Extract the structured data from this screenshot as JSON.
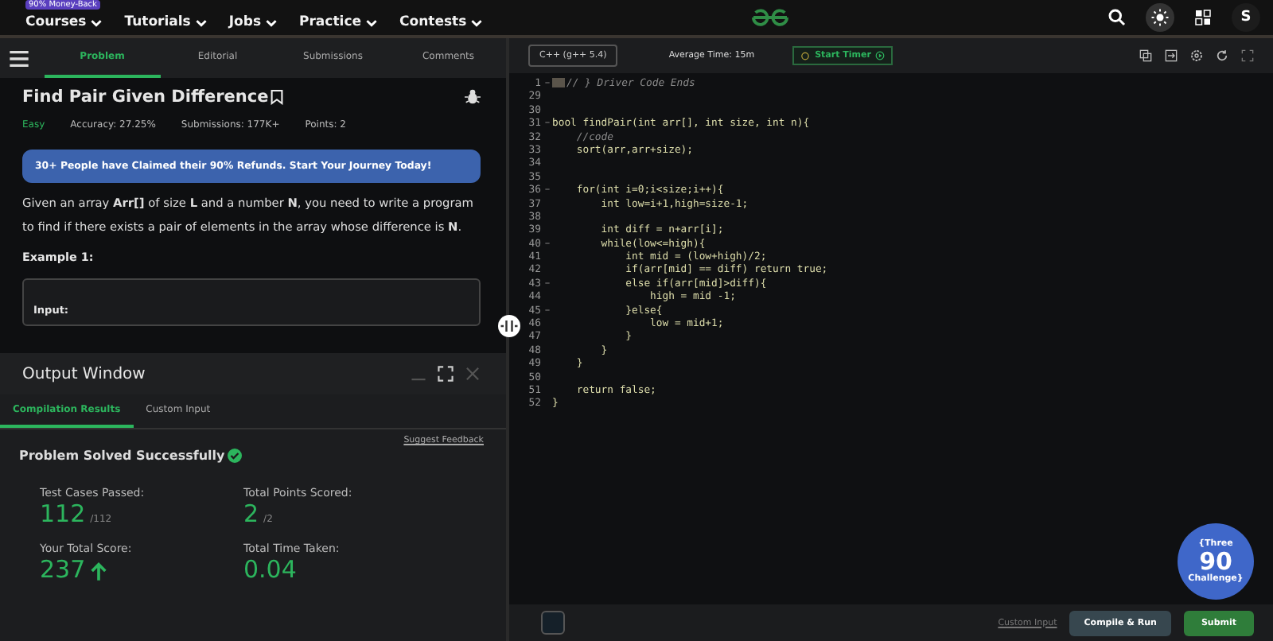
{
  "top_nav": {
    "promo_badge": "90% Money-Back",
    "items": [
      {
        "label": "Courses"
      },
      {
        "label": "Tutorials"
      },
      {
        "label": "Jobs"
      },
      {
        "label": "Practice"
      },
      {
        "label": "Contests"
      }
    ],
    "avatar": "S"
  },
  "problem_tabs": [
    {
      "label": "Problem",
      "selected": true
    },
    {
      "label": "Editorial",
      "selected": false
    },
    {
      "label": "Submissions",
      "selected": false
    },
    {
      "label": "Comments",
      "selected": false
    }
  ],
  "problem": {
    "title": "Find Pair Given Difference",
    "difficulty": "Easy",
    "accuracy": "Accuracy: 27.25%",
    "submissions": "Submissions: 177K+",
    "points": "Points: 2",
    "banner": "30+ People have Claimed their 90% Refunds. Start Your Journey Today!",
    "description": "Given an array **Arr[]** of size **L** and a number **N**, you need to write a program to find if there exists a pair of elements in the array whose difference is **N**.",
    "example_heading": "Example 1:",
    "example_input": "Input:"
  },
  "output_window": {
    "title": "Output Window",
    "tabs": [
      {
        "label": "Compilation Results",
        "selected": true
      },
      {
        "label": "Custom Input",
        "selected": false
      }
    ],
    "feedback_link": "Suggest Feedback",
    "status": "Problem Solved Successfully",
    "stats": [
      {
        "label": "Test Cases Passed:",
        "value": "112",
        "total": "/112",
        "arrow": false
      },
      {
        "label": "Total Points Scored:",
        "value": "2",
        "total": "/2",
        "arrow": false
      },
      {
        "label": "Your Total Score:",
        "value": "237",
        "arrow": true
      },
      {
        "label": "Total Time Taken:",
        "value": "0.04",
        "arrow": false
      }
    ]
  },
  "editor": {
    "language": "C++ (g++ 5.4)",
    "average_time": "Average Time: 15m",
    "timer_button": "Start Timer",
    "lines": [
      {
        "num": "1",
        "foldable": true,
        "kind": "collapsed",
        "text": "// } Driver Code Ends"
      },
      {
        "num": "29",
        "foldable": false,
        "kind": "code"
      },
      {
        "num": "30",
        "foldable": false,
        "kind": "code"
      },
      {
        "num": "31",
        "foldable": true,
        "kind": "code",
        "text": "bool findPair(int arr[], int size, int n){"
      },
      {
        "num": "32",
        "foldable": false,
        "kind": "comment",
        "text": "    //code"
      },
      {
        "num": "33",
        "foldable": false,
        "kind": "code",
        "text": "    sort(arr,arr+size);"
      },
      {
        "num": "34",
        "foldable": false,
        "kind": "code"
      },
      {
        "num": "35",
        "foldable": false,
        "kind": "code"
      },
      {
        "num": "36",
        "foldable": true,
        "kind": "code",
        "text": "    for(int i=0;i<size;i++){"
      },
      {
        "num": "37",
        "foldable": false,
        "kind": "code",
        "text": "        int low=i+1,high=size-1;"
      },
      {
        "num": "38",
        "foldable": false,
        "kind": "code"
      },
      {
        "num": "39",
        "foldable": false,
        "kind": "code",
        "text": "        int diff = n+arr[i];"
      },
      {
        "num": "40",
        "foldable": true,
        "kind": "code",
        "text": "        while(low<=high){"
      },
      {
        "num": "41",
        "foldable": false,
        "kind": "code",
        "text": "            int mid = (low+high)/2;"
      },
      {
        "num": "42",
        "foldable": false,
        "kind": "code",
        "text": "            if(arr[mid] == diff) return true;"
      },
      {
        "num": "43",
        "foldable": true,
        "kind": "code",
        "text": "            else if(arr[mid]>diff){"
      },
      {
        "num": "44",
        "foldable": false,
        "kind": "code",
        "text": "                high = mid -1;"
      },
      {
        "num": "45",
        "foldable": true,
        "kind": "code",
        "text": "            }else{"
      },
      {
        "num": "46",
        "foldable": false,
        "kind": "code",
        "text": "                low = mid+1;"
      },
      {
        "num": "47",
        "foldable": false,
        "kind": "code",
        "text": "            }"
      },
      {
        "num": "48",
        "foldable": false,
        "kind": "code",
        "text": "        }"
      },
      {
        "num": "49",
        "foldable": false,
        "kind": "code",
        "text": "    }"
      },
      {
        "num": "50",
        "foldable": false,
        "kind": "code"
      },
      {
        "num": "51",
        "foldable": false,
        "kind": "code",
        "text": "    return false;"
      },
      {
        "num": "52",
        "foldable": false,
        "kind": "code",
        "text": "}"
      }
    ],
    "custom_input_link": "Custom Input",
    "compile_button": "Compile & Run",
    "submit_button": "Submit"
  },
  "challenge_badge": {
    "top": "{Three",
    "number": "90",
    "bottom": "Challenge}"
  }
}
